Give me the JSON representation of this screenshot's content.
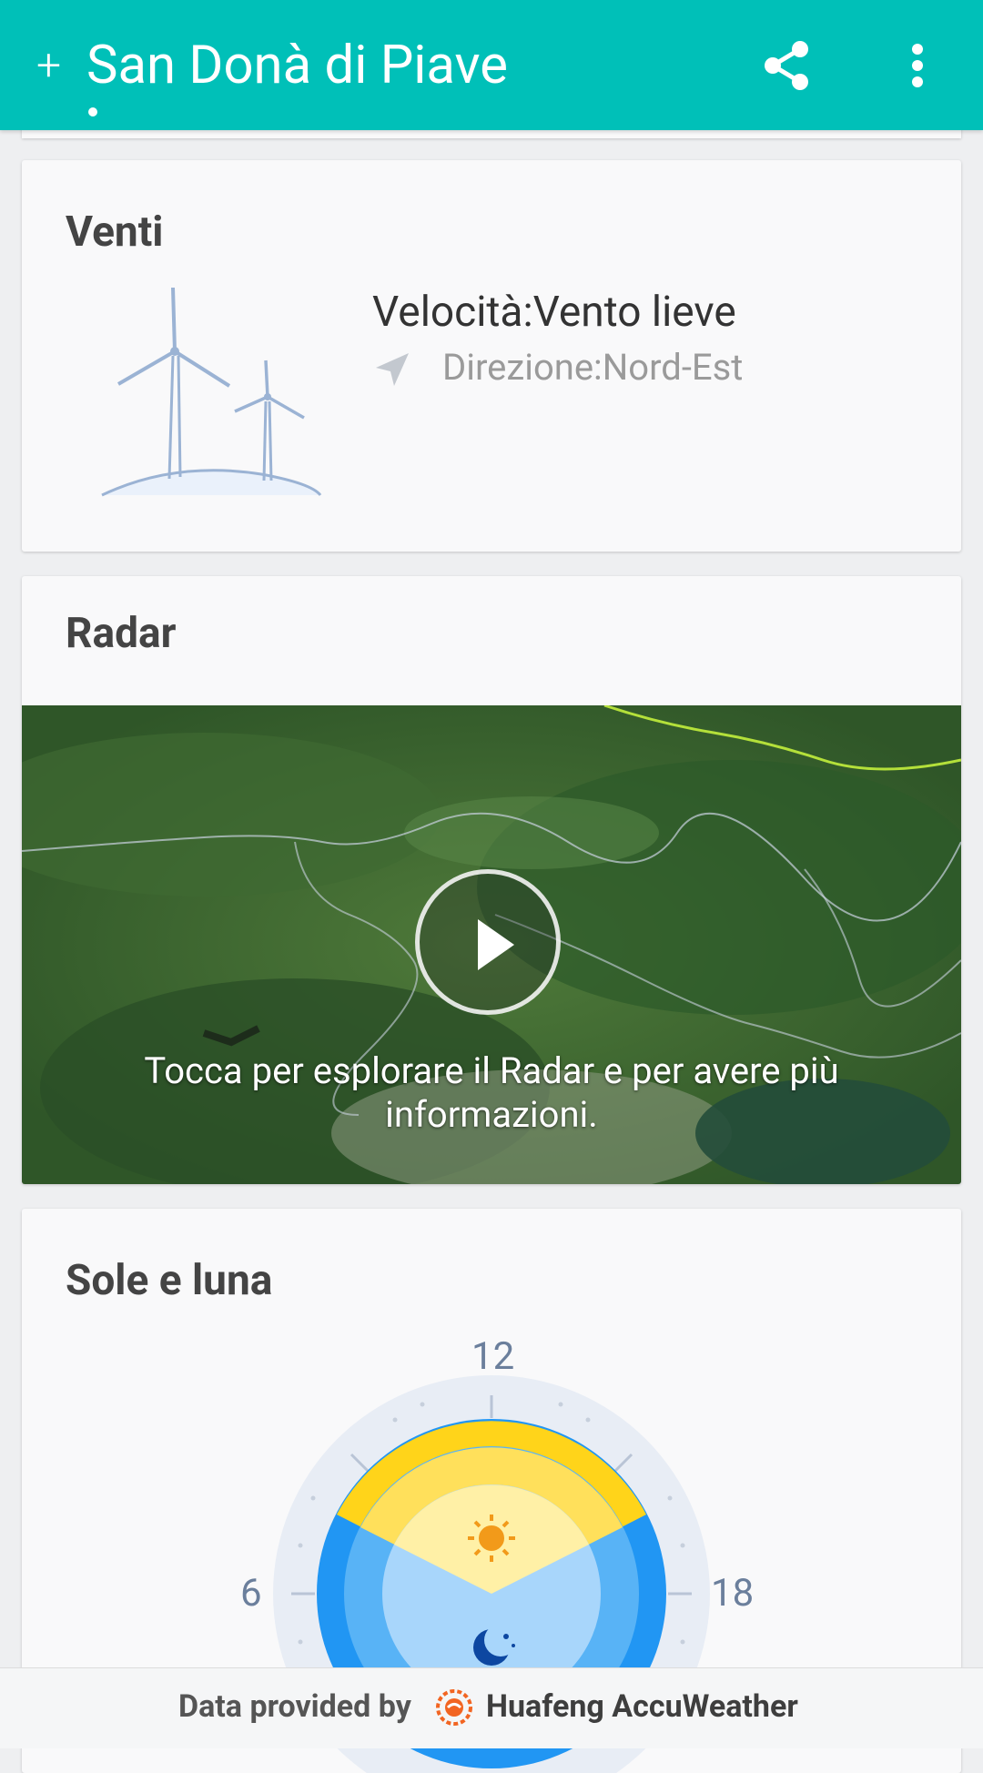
{
  "appbar": {
    "add_symbol": "+",
    "city": "San Donà di Piave"
  },
  "wind": {
    "title": "Venti",
    "speed": "Velocità:Vento lieve",
    "direction": "Direzione:Nord-Est"
  },
  "radar": {
    "title": "Radar",
    "caption": "Tocca per esplorare il Radar e per avere più informazioni."
  },
  "sun_moon": {
    "title": "Sole e luna",
    "label_top": "12",
    "label_left": "6",
    "label_right": "18"
  },
  "footer": {
    "prefix": "Data provided by",
    "brand": "Huafeng AccuWeather"
  },
  "colors": {
    "appbar": "#00c0b8",
    "sun": "#ffd41a",
    "moon": "#2196f3"
  }
}
